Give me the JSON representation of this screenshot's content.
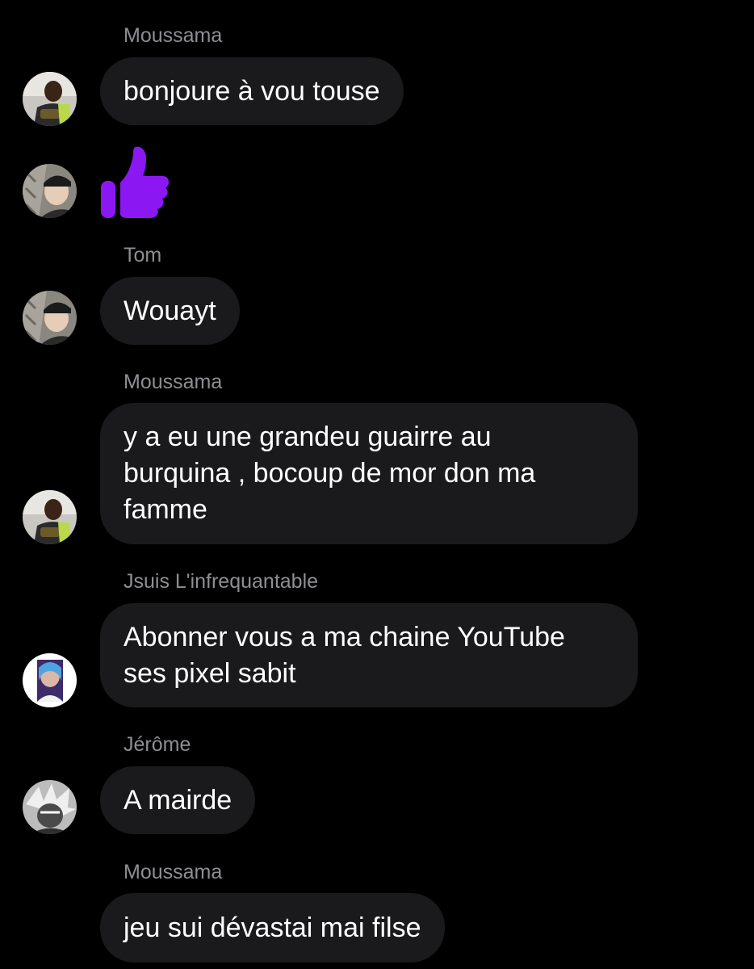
{
  "accent_color": "#8b18f2",
  "bubble_color": "#1a1a1c",
  "messages": [
    {
      "sender": "Moussama",
      "text": "bonjoure à vou touse",
      "avatar": "avatar-moussama"
    },
    {
      "sender": "",
      "text": "",
      "reaction": "thumbs-up-icon",
      "avatar": "avatar-tom"
    },
    {
      "sender": "Tom",
      "text": "Wouayt",
      "avatar": "avatar-tom"
    },
    {
      "sender": "Moussama",
      "text": "y a eu une grandeu guairre au\nburquina , bocoup de mor don ma\nfamme",
      "avatar": "avatar-moussama"
    },
    {
      "sender": "Jsuis L'infrequantable",
      "text": "Abonner vous a ma chaine YouTube\nses pixel sabit",
      "avatar": "avatar-jsuis"
    },
    {
      "sender": "Jérôme",
      "text": "A mairde",
      "avatar": "avatar-jerome"
    },
    {
      "sender": "Moussama",
      "text": "jeu sui dévastai mai filse",
      "avatar": ""
    }
  ]
}
